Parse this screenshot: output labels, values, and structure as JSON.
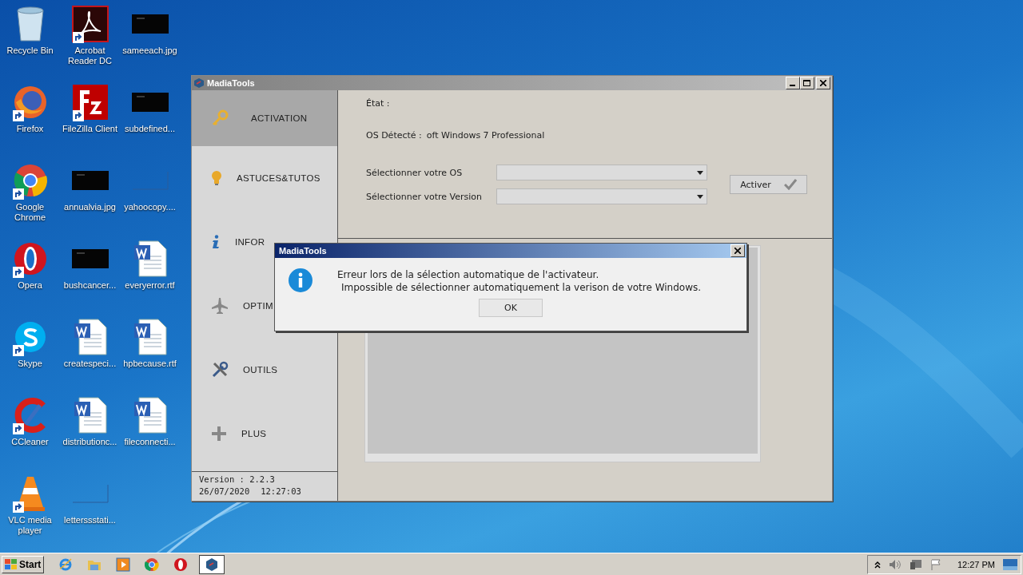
{
  "desktop_icons": [
    {
      "label": "Recycle Bin",
      "kind": "recycle",
      "shortcut": false
    },
    {
      "label": "Firefox",
      "kind": "firefox",
      "shortcut": true
    },
    {
      "label": "Google Chrome",
      "kind": "chrome",
      "shortcut": true
    },
    {
      "label": "Opera",
      "kind": "opera",
      "shortcut": true
    },
    {
      "label": "Skype",
      "kind": "skype",
      "shortcut": true
    },
    {
      "label": "CCleaner",
      "kind": "ccleaner",
      "shortcut": true
    },
    {
      "label": "VLC media player",
      "kind": "vlc",
      "shortcut": true
    },
    {
      "label": "Acrobat Reader DC",
      "kind": "acrobat",
      "shortcut": true
    },
    {
      "label": "FileZilla Client",
      "kind": "filezilla",
      "shortcut": true
    },
    {
      "label": "annualvia.jpg",
      "kind": "image",
      "shortcut": false
    },
    {
      "label": "bushcancer...",
      "kind": "image",
      "shortcut": false
    },
    {
      "label": "createspeci...",
      "kind": "document",
      "shortcut": false
    },
    {
      "label": "distributionc...",
      "kind": "document",
      "shortcut": false
    },
    {
      "label": "letterssstati...",
      "kind": "blank",
      "shortcut": false
    },
    {
      "label": "sameeach.jpg",
      "kind": "image",
      "shortcut": false
    },
    {
      "label": "subdefined...",
      "kind": "image",
      "shortcut": false
    },
    {
      "label": "yahoocopy....",
      "kind": "blank",
      "shortcut": false
    },
    {
      "label": "everyerror.rtf",
      "kind": "document",
      "shortcut": false
    },
    {
      "label": "hpbecause.rtf",
      "kind": "document",
      "shortcut": false
    },
    {
      "label": "fileconnecti...",
      "kind": "document",
      "shortcut": false
    }
  ],
  "window": {
    "title": "MadiaTools",
    "sidebar": {
      "items": [
        {
          "label": "ACTIVATION",
          "kind": "key",
          "selected": true
        },
        {
          "label": "ASTUCES&TUTOS",
          "kind": "bulb",
          "selected": false
        },
        {
          "label": "INFOR",
          "kind": "info",
          "selected": false
        },
        {
          "label": "OPTIM",
          "kind": "plane",
          "selected": false
        },
        {
          "label": "OUTILS",
          "kind": "tools",
          "selected": false
        },
        {
          "label": "PLUS",
          "kind": "plus",
          "selected": false
        }
      ],
      "version": "Version : 2.2.3",
      "date": "26/07/2020",
      "time": "12:27:03"
    },
    "status_label": "État :",
    "os_label": "OS Détecté :",
    "os_value": "oft Windows 7 Professional",
    "fields": [
      {
        "label": "Sélectionner votre OS"
      },
      {
        "label": "Sélectionner votre Version"
      }
    ],
    "activate_button": "Activer"
  },
  "dialog": {
    "title": "MadiaTools",
    "lines": [
      "Erreur lors de la sélection automatique de l'activateur.",
      "Impossible de sélectionner automatiquement la verison de votre Windows."
    ],
    "button": "OK"
  },
  "taskbar": {
    "start": "Start",
    "apps": [
      {
        "kind": "ie",
        "selected": false
      },
      {
        "kind": "folder",
        "selected": false
      },
      {
        "kind": "media",
        "selected": false
      },
      {
        "kind": "chrome",
        "selected": false
      },
      {
        "kind": "opera",
        "selected": false
      },
      {
        "kind": "app",
        "selected": true
      }
    ],
    "clock": "12:27 PM"
  }
}
